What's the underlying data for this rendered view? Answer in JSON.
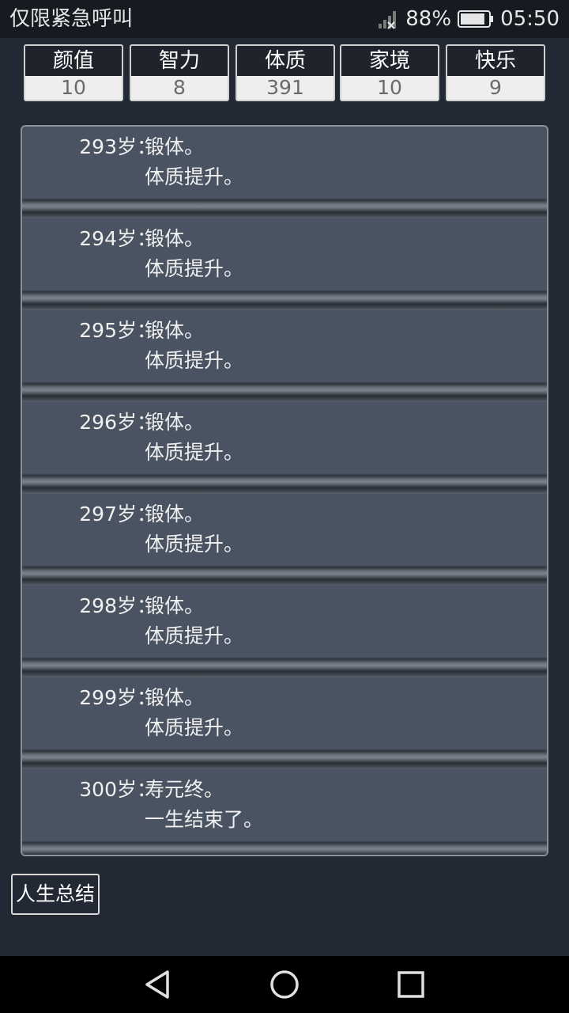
{
  "status_bar": {
    "carrier_text": "仅限紧急呼叫",
    "battery_percent": "88%",
    "time": "05:50",
    "battery_level": 0.88
  },
  "stats": [
    {
      "label": "颜值",
      "value": "10"
    },
    {
      "label": "智力",
      "value": "8"
    },
    {
      "label": "体质",
      "value": "391"
    },
    {
      "label": "家境",
      "value": "10"
    },
    {
      "label": "快乐",
      "value": "9"
    }
  ],
  "log": [
    {
      "age": "293岁：",
      "line1": "锻体。",
      "line2": "体质提升。"
    },
    {
      "age": "294岁：",
      "line1": "锻体。",
      "line2": "体质提升。"
    },
    {
      "age": "295岁：",
      "line1": "锻体。",
      "line2": "体质提升。"
    },
    {
      "age": "296岁：",
      "line1": "锻体。",
      "line2": "体质提升。"
    },
    {
      "age": "297岁：",
      "line1": "锻体。",
      "line2": "体质提升。"
    },
    {
      "age": "298岁：",
      "line1": "锻体。",
      "line2": "体质提升。"
    },
    {
      "age": "299岁：",
      "line1": "锻体。",
      "line2": "体质提升。"
    },
    {
      "age": "300岁：",
      "line1": "寿元终。",
      "line2": "一生结束了。"
    }
  ],
  "summary_button": {
    "label": "人生总结"
  },
  "icons": {
    "signal": "signal-icon",
    "battery": "battery-icon",
    "back": "back-icon",
    "home": "home-icon",
    "recent": "recent-apps-icon"
  }
}
